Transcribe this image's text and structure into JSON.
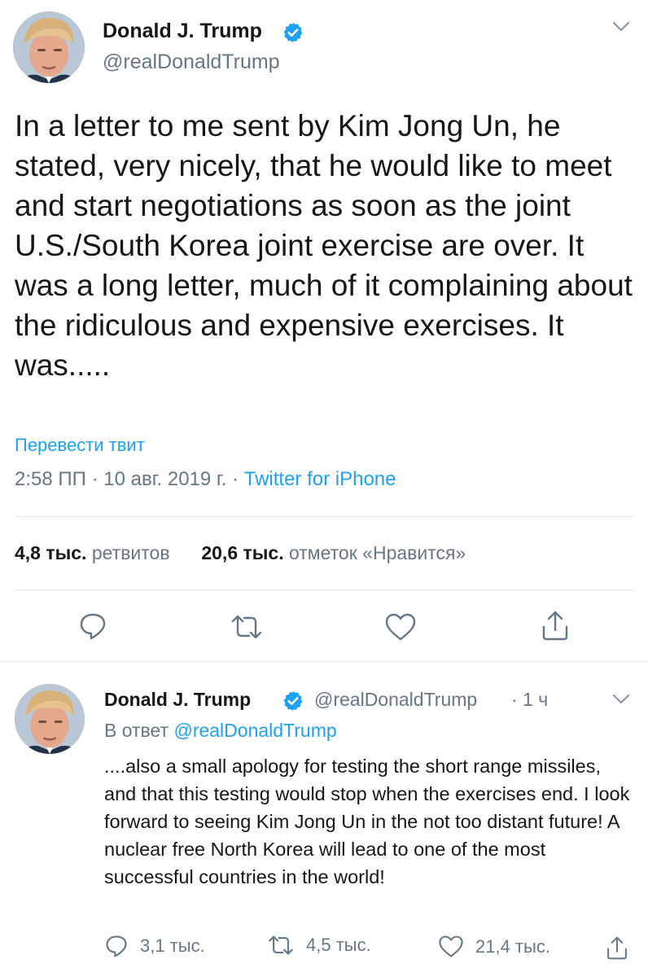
{
  "tweet1": {
    "author_name": "Donald J. Trump",
    "author_handle": "@realDonaldTrump",
    "text": "In a letter to me sent by Kim Jong Un, he stated, very nicely, that he would like to meet and start negotiations as soon as the joint U.S./South Korea joint exercise are over. It was a long letter, much of it complaining about the ridiculous and expensive exercises. It was.....",
    "translate_label": "Перевести твит",
    "time": "2:58 ПП",
    "date": "10 авг. 2019 г.",
    "separator": "·",
    "source": "Twitter for iPhone",
    "retweets_count": "4,8 тыс.",
    "retweets_label": "ретвитов",
    "likes_count": "20,6 тыс.",
    "likes_label": "отметок «Нравится»"
  },
  "tweet2": {
    "author_name": "Donald J. Trump",
    "author_handle": "@realDonaldTrump",
    "time_ago": "· 1 ч",
    "reply_prefix": "В ответ",
    "reply_to": "@realDonaldTrump",
    "text": "....also a small apology for testing the short range missiles, and that this testing would stop when the exercises end. I look forward to seeing Kim Jong Un in the not too distant future! A nuclear free North Korea will lead to one of the most successful countries in the world!",
    "replies": "3,1 тыс.",
    "retweets": "4,5 тыс.",
    "likes": "21,4 тыс."
  },
  "icons": {
    "verified": "verified-badge-icon",
    "chevron": "chevron-down-icon",
    "reply": "reply-icon",
    "retweet": "retweet-icon",
    "like": "heart-icon",
    "share": "share-icon"
  },
  "colors": {
    "accent": "#1da1f2",
    "text": "#14171a",
    "secondary": "#657786",
    "divider": "#e1e8ed"
  }
}
